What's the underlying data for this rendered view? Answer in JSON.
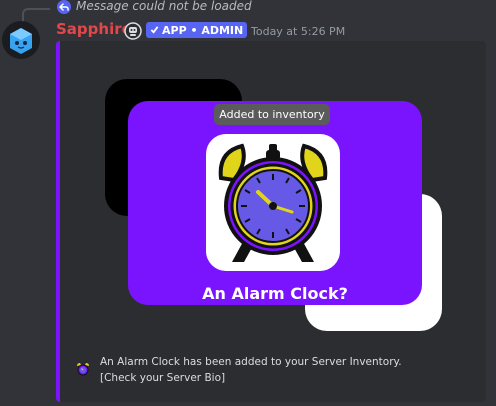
{
  "reply": {
    "text": "Message could not be loaded",
    "icon": "reply-arrow-icon"
  },
  "message": {
    "author": "Sapphire",
    "badge_label": "APP • ADMIN",
    "badge_icon": "checkmark-icon",
    "timestamp": "Today at 5:26 PM"
  },
  "embed": {
    "accent_color": "#7a14ff",
    "tooltip": "Added to inventory",
    "item_name": "An Alarm Clock?",
    "footer_line1": "An Alarm Clock has been added to your Server Inventory.",
    "footer_line2": "[Check your Server Bio]"
  },
  "colors": {
    "background": "#313338",
    "embed_bg": "#2b2d31",
    "username": "#e3474a",
    "badge": "#5865f2"
  }
}
